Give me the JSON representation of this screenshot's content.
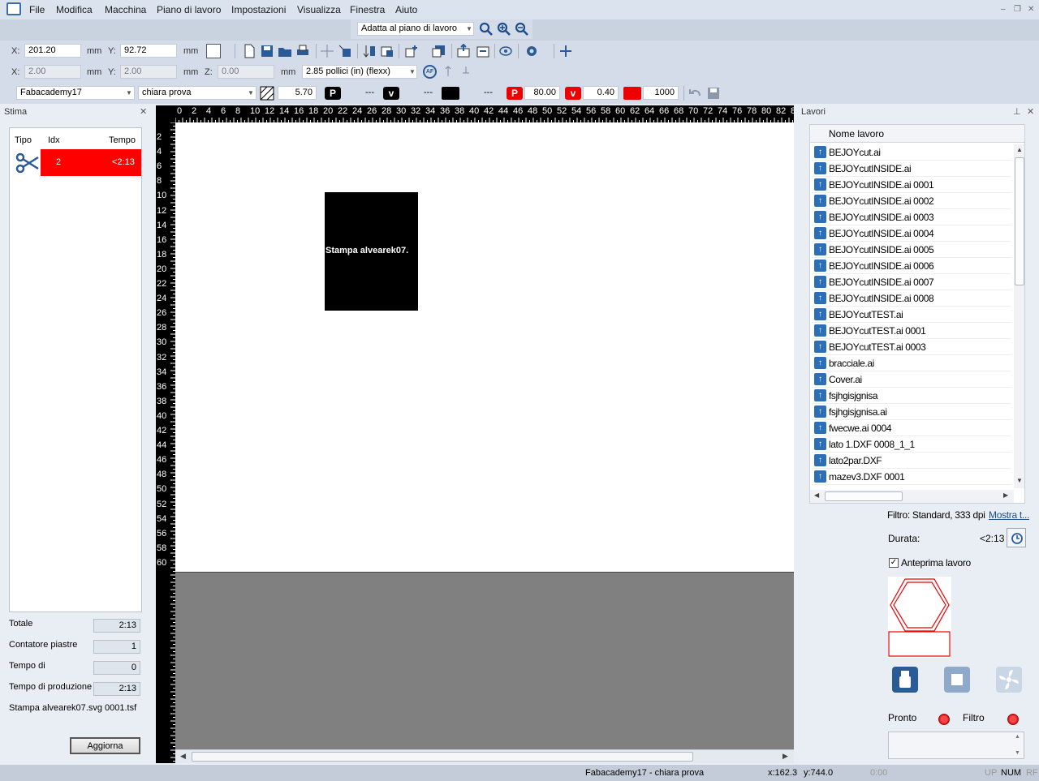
{
  "menu": {
    "items": [
      "File",
      "Modifica",
      "Macchina",
      "Piano di lavoro",
      "Impostazioni",
      "Visualizza",
      "Finestra",
      "Aiuto"
    ],
    "win_min": "–",
    "win_restore": "❐",
    "win_close": "✕"
  },
  "zoombar": {
    "select_value": "Adatta al piano di lavoro"
  },
  "position": {
    "x_label": "X:",
    "x_value": "201.20",
    "x_unit": "mm",
    "y_label": "Y:",
    "y_value": "92.72",
    "y_unit": "mm"
  },
  "size": {
    "x_label": "X:",
    "x_value": "2.00",
    "x_unit": "mm",
    "y_label": "Y:",
    "y_value": "2.00",
    "y_unit": "mm",
    "z_label": "Z:",
    "z_value": "0.00",
    "z_unit": "mm",
    "focus_select": "2.85 pollici (in) (flexx)"
  },
  "params": {
    "material": "Fabacademy17",
    "process": "chiara prova",
    "hatch_value": "5.70",
    "p_value": "---",
    "v_value": "---",
    "freq_value": "---",
    "cut_p": "80.00",
    "cut_v": "0.40",
    "cut_freq": "1000"
  },
  "stima": {
    "title": "Stima",
    "close": "✕",
    "columns": [
      "Tipo",
      "Idx",
      "Tempo"
    ],
    "row": {
      "idx": "2",
      "tempo": "<2:13"
    },
    "totale_label": "Totale",
    "totale_value": "2:13",
    "contatore_label": "Contatore piastre",
    "contatore_value": "1",
    "movimentazione_label": "Tempo di movimentazione",
    "movimentazione_value": "0",
    "produzione_label": "Tempo di produzione",
    "produzione_value": "2:13",
    "file": "Stampa alvearek07.svg 0001.tsf",
    "aggiorna": "Aggiorna"
  },
  "canvas": {
    "object_label": "Stampa alvearek07.",
    "ruler_h": [
      "0",
      "2",
      "4",
      "6",
      "8",
      "10",
      "12",
      "14",
      "16",
      "18",
      "20",
      "22",
      "24",
      "26",
      "28",
      "30",
      "32",
      "34",
      "36",
      "38",
      "40",
      "42",
      "44",
      "46",
      "48",
      "50",
      "52",
      "54",
      "56",
      "58",
      "60",
      "62",
      "64",
      "66",
      "68",
      "70",
      "72",
      "74",
      "76",
      "78",
      "80",
      "82",
      "8"
    ],
    "ruler_v": [
      "2",
      "4",
      "6",
      "8",
      "10",
      "12",
      "14",
      "16",
      "18",
      "20",
      "22",
      "24",
      "26",
      "28",
      "30",
      "32",
      "34",
      "36",
      "38",
      "40",
      "42",
      "44",
      "46",
      "48",
      "50",
      "52",
      "54",
      "56",
      "58",
      "60"
    ]
  },
  "lavori": {
    "title": "Lavori",
    "pin": "⊥",
    "close": "✕",
    "column": "Nome lavoro",
    "jobs": [
      "BEJOYcut.ai",
      "BEJOYcutINSIDE.ai",
      "BEJOYcutINSIDE.ai 0001",
      "BEJOYcutINSIDE.ai 0002",
      "BEJOYcutINSIDE.ai 0003",
      "BEJOYcutINSIDE.ai 0004",
      "BEJOYcutINSIDE.ai 0005",
      "BEJOYcutINSIDE.ai 0006",
      "BEJOYcutINSIDE.ai 0007",
      "BEJOYcutINSIDE.ai 0008",
      "BEJOYcutTEST.ai",
      "BEJOYcutTEST.ai 0001",
      "BEJOYcutTEST.ai 0003",
      "bracciale.ai",
      "Cover.ai",
      "fsjhgisjgnisa",
      "fsjhgisjgnisa.ai",
      "fwecwe.ai 0004",
      "lato 1.DXF 0008_1_1",
      "lato2par.DXF",
      "mazev3.DXF 0001"
    ],
    "filtro": "Filtro: Standard, 333 dpi",
    "mostra": "Mostra t...",
    "durata_label": "Durata:",
    "durata_value": "<2:13",
    "anteprima_label": "Anteprima lavoro",
    "pronto_label": "Pronto",
    "filtro_label": "Filtro"
  },
  "status": {
    "job": "Fabacademy17 - chiara prova",
    "x": "x:162.3",
    "y": "y:744.0",
    "time": "0:00",
    "up": "UP",
    "num": "NUM",
    "rf": "RF"
  }
}
